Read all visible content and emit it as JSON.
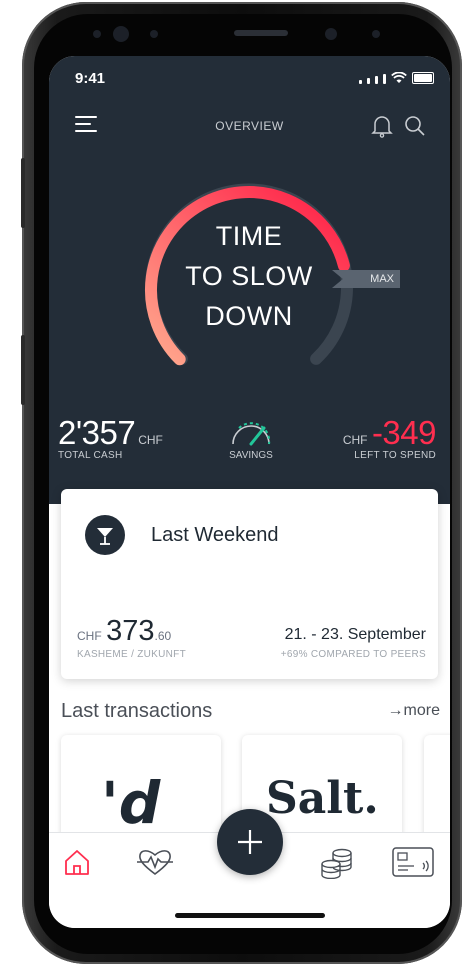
{
  "status_bar": {
    "time": "9:41"
  },
  "header": {
    "title": "OVERVIEW"
  },
  "gauge": {
    "message_line1": "TIME",
    "message_line2": "TO SLOW",
    "message_line3": "DOWN",
    "max_label": "MAX",
    "fill_fraction": 0.78
  },
  "stats": {
    "total_cash_value": "2'357",
    "total_cash_unit": "CHF",
    "total_cash_label": "TOTAL CASH",
    "savings_label": "SAVINGS",
    "left_unit": "CHF",
    "left_value": "-349",
    "left_label": "LEFT TO SPEND"
  },
  "weekend_card": {
    "title": "Last Weekend",
    "currency": "CHF",
    "amount_int": "373",
    "amount_dec": ".60",
    "amount_caption": "KASHEME / ZUKUNFT",
    "date_range": "21. - 23. September",
    "compare": "+69% COMPARED TO PEERS"
  },
  "transactions": {
    "title": "Last transactions",
    "more": "→more",
    "items": [
      {
        "logo_text": "'d"
      },
      {
        "logo_text": "Salt."
      }
    ]
  },
  "tabbar": {
    "icons": [
      "home-icon",
      "heart-rate-icon",
      "plus-icon",
      "coins-icon",
      "card-icon"
    ]
  },
  "colors": {
    "accent": "#ff2e4f",
    "dark_bg": "#232d38"
  }
}
